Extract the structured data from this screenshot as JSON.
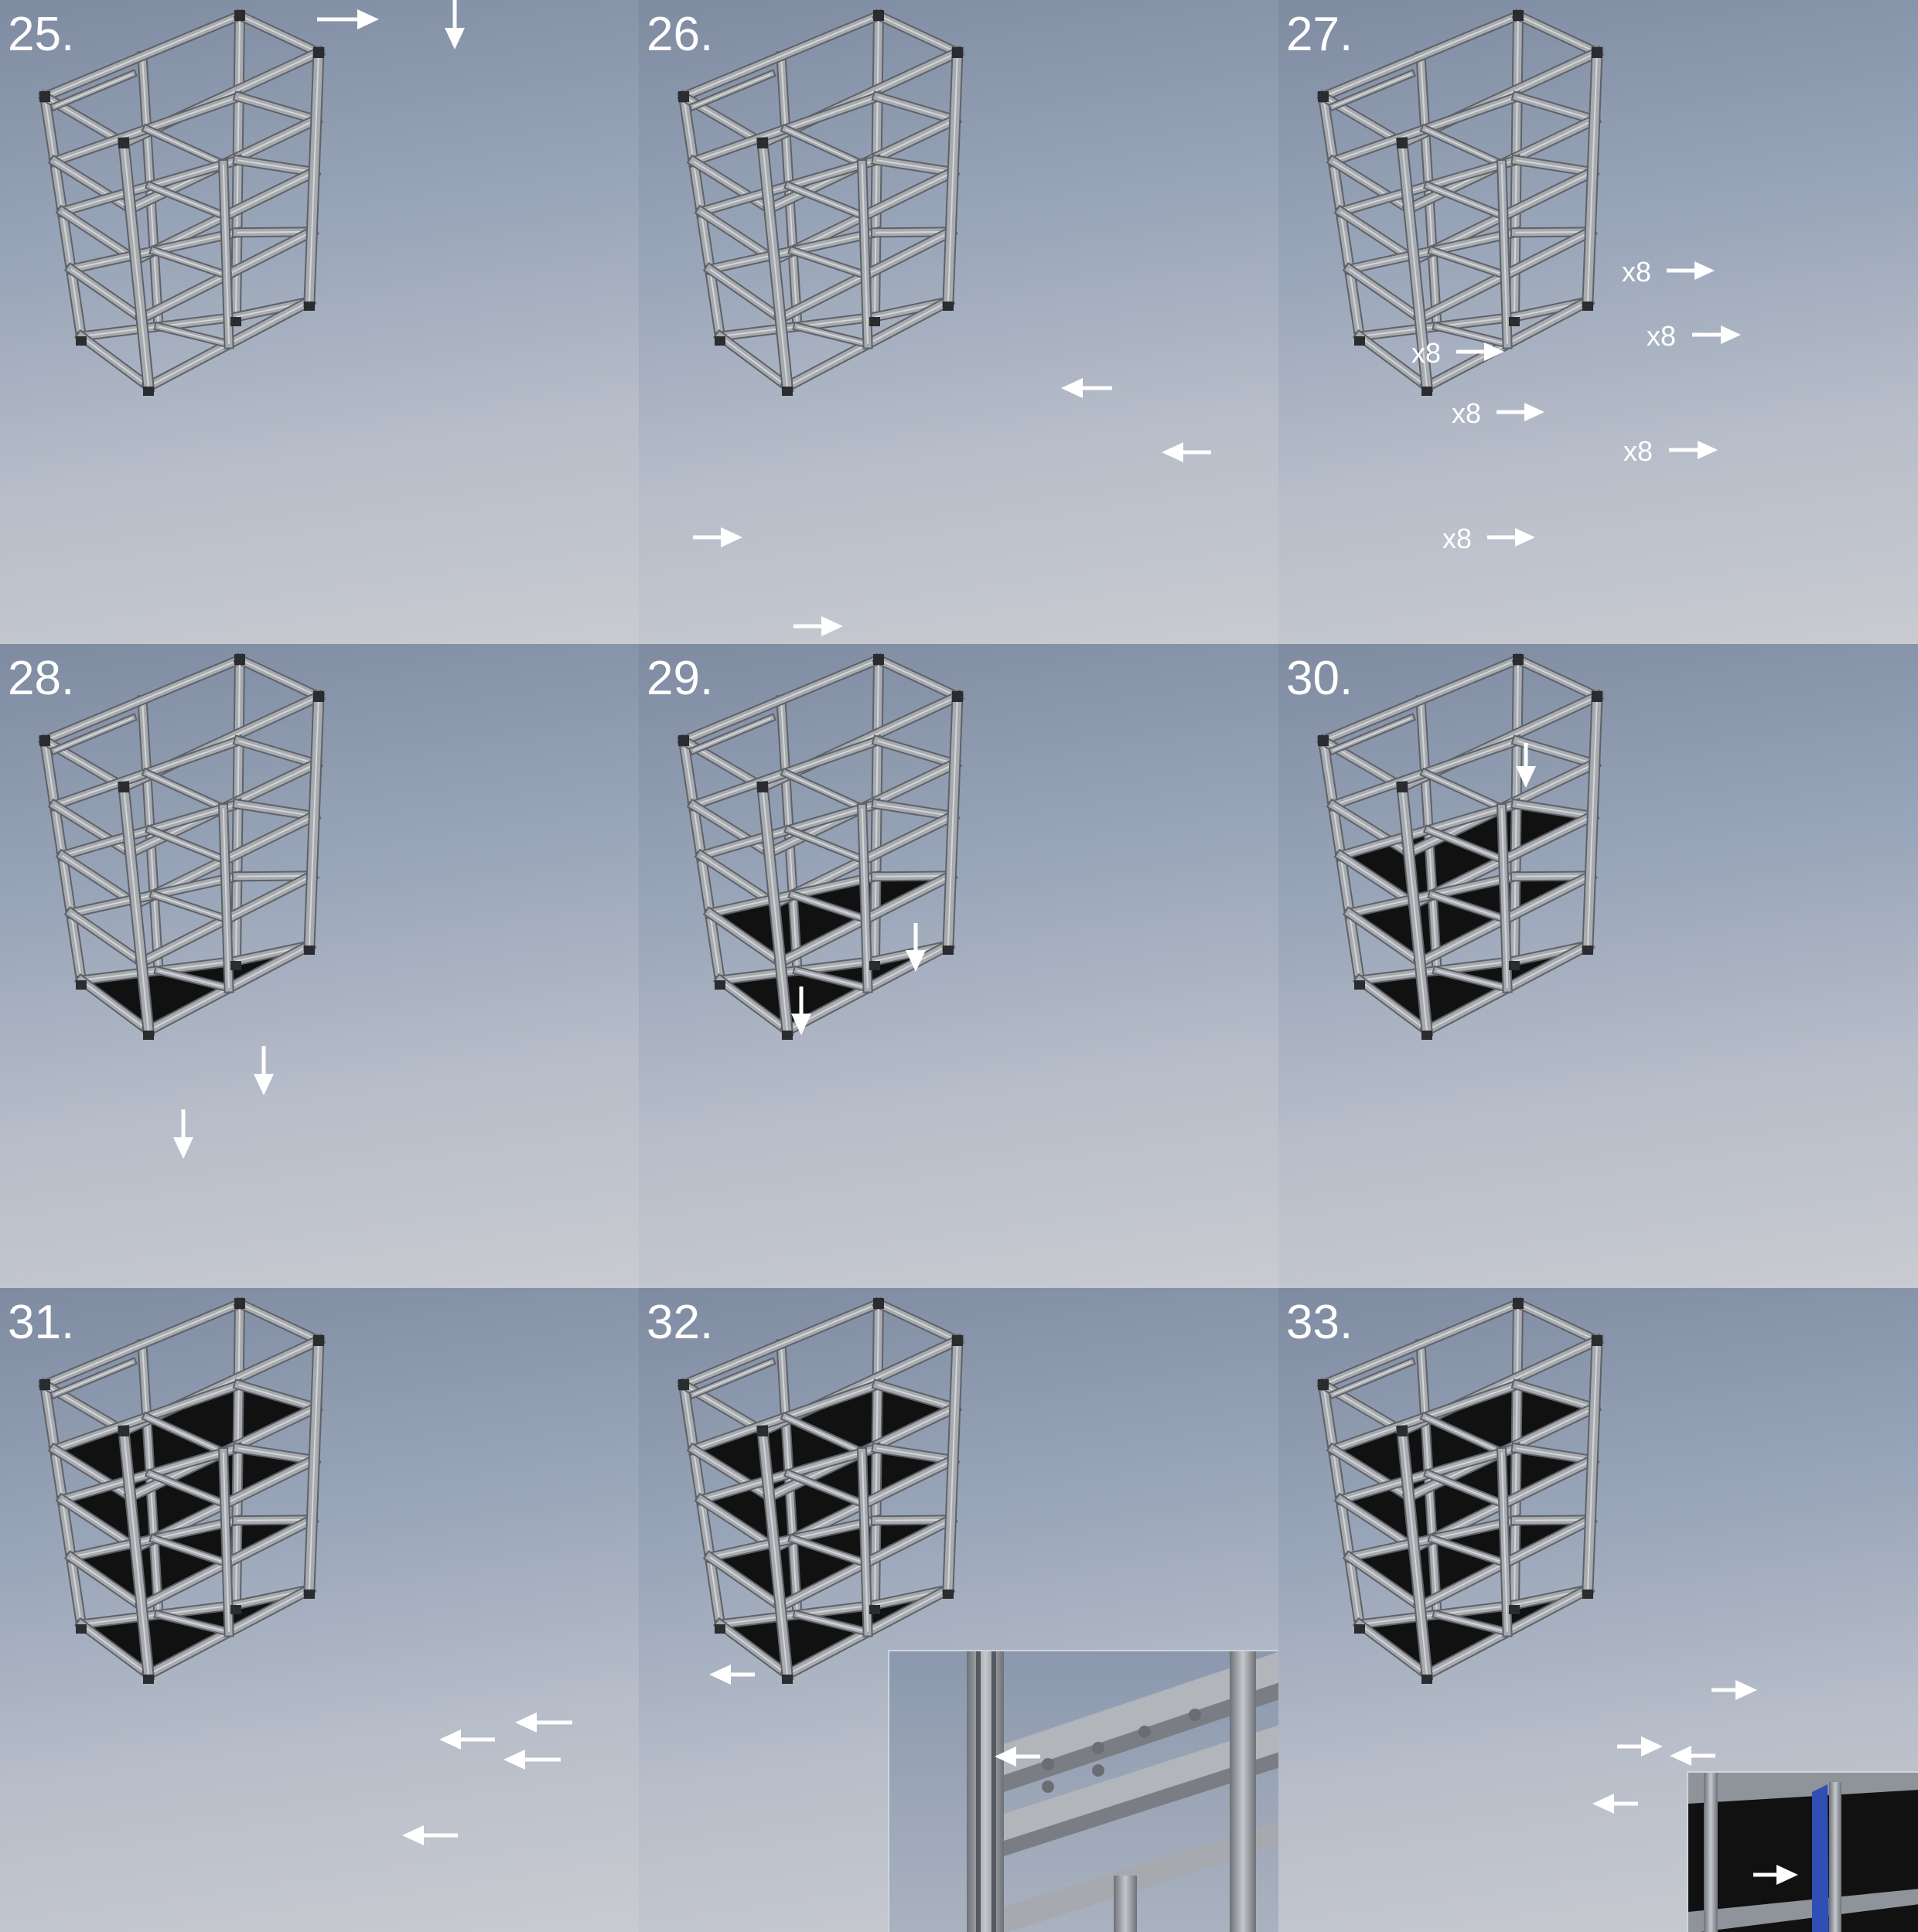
{
  "panels": [
    {
      "number": "25."
    },
    {
      "number": "26."
    },
    {
      "number": "27.",
      "labels": [
        "x8",
        "x8",
        "x8",
        "x8",
        "x8",
        "x8"
      ]
    },
    {
      "number": "28."
    },
    {
      "number": "29."
    },
    {
      "number": "30."
    },
    {
      "number": "31."
    },
    {
      "number": "32."
    },
    {
      "number": "33."
    }
  ],
  "colors": {
    "aluminum": "#a7aaae",
    "aluminum_shadow": "#5e6268",
    "shelf_panel": "#111111",
    "arrow": "#ffffff",
    "highlight_part": "#2f4fb4"
  }
}
